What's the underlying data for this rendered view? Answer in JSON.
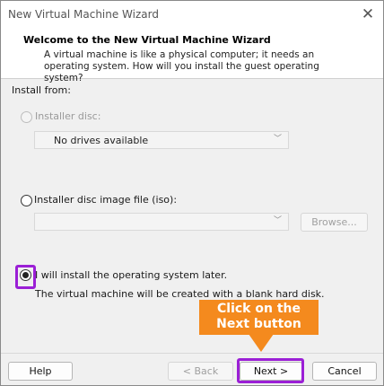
{
  "window": {
    "title": "New Virtual Machine Wizard"
  },
  "header": {
    "title": "Welcome to the New Virtual Machine Wizard",
    "description": "A virtual machine is like a physical computer; it needs an operating system. How will you install the guest operating system?"
  },
  "install_from": {
    "label": "Install from:",
    "options": [
      {
        "label": "Installer disc:",
        "selected": false,
        "enabled": false,
        "dropdown_value": "No drives available"
      },
      {
        "label": "Installer disc image file (iso):",
        "selected": false,
        "enabled": true,
        "dropdown_value": "",
        "browse_label": "Browse..."
      },
      {
        "label": "I will install the operating system later.",
        "selected": true,
        "enabled": true,
        "note": "The virtual machine will be created with a blank hard disk."
      }
    ]
  },
  "annotation": {
    "callout_text": "Click on the Next button",
    "color": "#f48a1e",
    "highlight_color": "#9b1fd6"
  },
  "footer": {
    "help_label": "Help",
    "back_label": "< Back",
    "next_label": "Next >",
    "cancel_label": "Cancel"
  }
}
